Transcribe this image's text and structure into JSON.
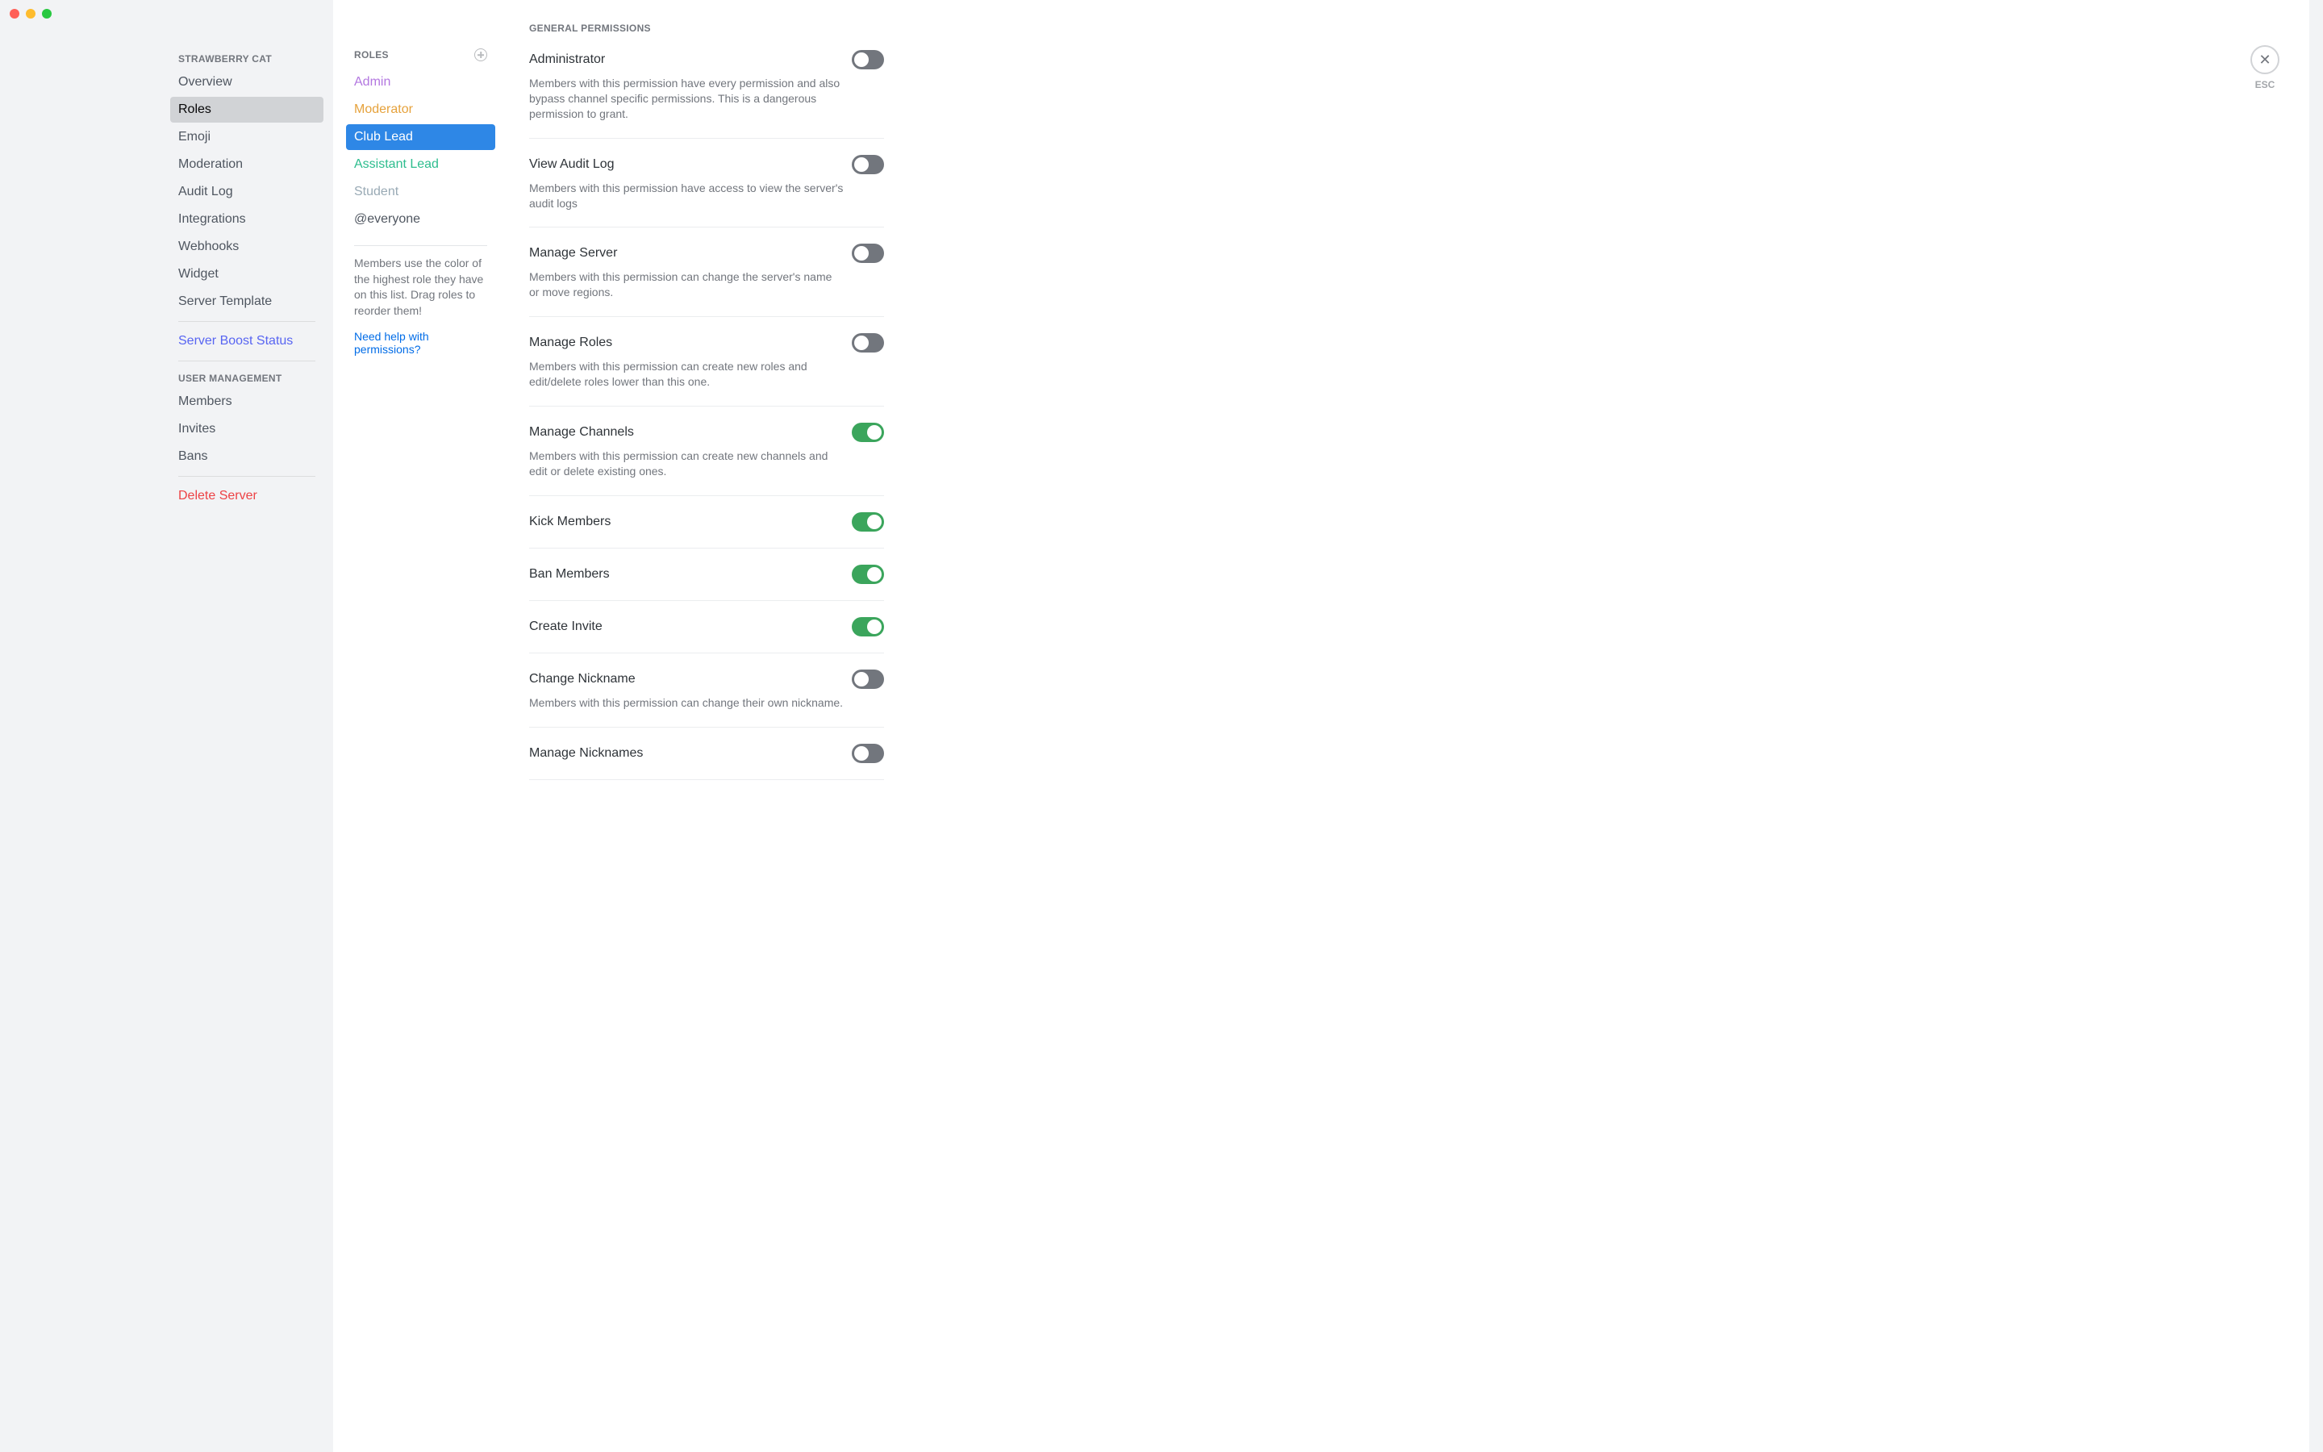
{
  "traffic_lights": [
    "close",
    "minimize",
    "zoom"
  ],
  "server": {
    "name": "STRAWBERRY CAT"
  },
  "sidebar": {
    "settings_heading": "STRAWBERRY CAT",
    "items": [
      {
        "label": "Overview",
        "active": false
      },
      {
        "label": "Roles",
        "active": true
      },
      {
        "label": "Emoji",
        "active": false
      },
      {
        "label": "Moderation",
        "active": false
      },
      {
        "label": "Audit Log",
        "active": false
      },
      {
        "label": "Integrations",
        "active": false
      },
      {
        "label": "Webhooks",
        "active": false
      },
      {
        "label": "Widget",
        "active": false
      },
      {
        "label": "Server Template",
        "active": false
      }
    ],
    "boost_label": "Server Boost Status",
    "user_mgmt_heading": "USER MANAGEMENT",
    "user_mgmt_items": [
      {
        "label": "Members"
      },
      {
        "label": "Invites"
      },
      {
        "label": "Bans"
      }
    ],
    "delete_label": "Delete Server"
  },
  "roles": {
    "heading": "ROLES",
    "list": [
      {
        "label": "Admin",
        "color": "#b377e0",
        "selected": false
      },
      {
        "label": "Moderator",
        "color": "#e6a23c",
        "selected": false
      },
      {
        "label": "Club Lead",
        "color": "#ffffff",
        "selected": true
      },
      {
        "label": "Assistant Lead",
        "color": "#2dbd8e",
        "selected": false
      },
      {
        "label": "Student",
        "color": "#99aab5",
        "selected": false
      },
      {
        "label": "@everyone",
        "color": "#4f5660",
        "selected": false
      }
    ],
    "hint": "Members use the color of the highest role they have on this list. Drag roles to reorder them!",
    "help_link": "Need help with permissions?"
  },
  "permissions": {
    "section_title": "GENERAL PERMISSIONS",
    "items": [
      {
        "name": "Administrator",
        "desc": "Members with this permission have every permission and also bypass channel specific permissions. This is a dangerous permission to grant.",
        "on": false
      },
      {
        "name": "View Audit Log",
        "desc": "Members with this permission have access to view the server's audit logs",
        "on": false
      },
      {
        "name": "Manage Server",
        "desc": "Members with this permission can change the server's name or move regions.",
        "on": false
      },
      {
        "name": "Manage Roles",
        "desc": "Members with this permission can create new roles and edit/delete roles lower than this one.",
        "on": false
      },
      {
        "name": "Manage Channels",
        "desc": "Members with this permission can create new channels and edit or delete existing ones.",
        "on": true
      },
      {
        "name": "Kick Members",
        "desc": "",
        "on": true
      },
      {
        "name": "Ban Members",
        "desc": "",
        "on": true
      },
      {
        "name": "Create Invite",
        "desc": "",
        "on": true
      },
      {
        "name": "Change Nickname",
        "desc": "Members with this permission can change their own nickname.",
        "on": false
      },
      {
        "name": "Manage Nicknames",
        "desc": "",
        "on": false
      }
    ]
  },
  "close": {
    "esc_label": "ESC"
  }
}
